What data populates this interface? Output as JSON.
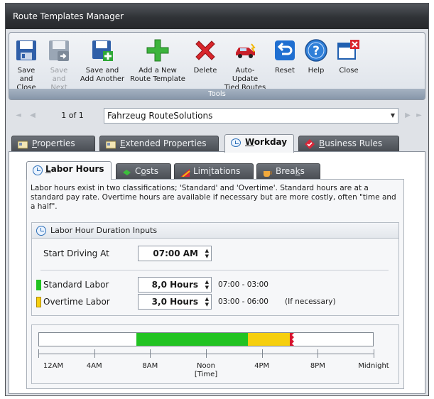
{
  "window": {
    "title": "Route Templates Manager"
  },
  "toolbar": {
    "group_label": "Tools",
    "buttons": [
      {
        "id": "save-close",
        "label": "Save and\nClose",
        "enabled": true
      },
      {
        "id": "save-next",
        "label": "Save and\nNext",
        "enabled": false
      },
      {
        "id": "save-add",
        "label": "Save and\nAdd Another",
        "enabled": true
      },
      {
        "id": "add-new",
        "label": "Add a New\nRoute Template",
        "enabled": true
      },
      {
        "id": "delete",
        "label": "Delete",
        "enabled": true
      },
      {
        "id": "auto-update",
        "label": "Auto-Update\nTied Routes",
        "enabled": true
      },
      {
        "id": "reset",
        "label": "Reset",
        "enabled": true
      },
      {
        "id": "help",
        "label": "Help",
        "enabled": true
      },
      {
        "id": "close",
        "label": "Close",
        "enabled": true
      }
    ]
  },
  "navigator": {
    "count": "1 of 1",
    "selected": "Fahrzeug RouteSolutions"
  },
  "main_tabs": [
    {
      "label": "Properties",
      "accesskey": "P",
      "active": false
    },
    {
      "label": "Extended Properties",
      "accesskey": "E",
      "active": false
    },
    {
      "label": "Workday",
      "accesskey": "W",
      "active": true
    },
    {
      "label": "Business Rules",
      "accesskey": "B",
      "active": false
    }
  ],
  "sub_tabs": [
    {
      "label": "Labor Hours",
      "accesskey": "L",
      "active": true
    },
    {
      "label": "Costs",
      "accesskey": "o",
      "active": false
    },
    {
      "label": "Limitations",
      "accesskey": "i",
      "active": false
    },
    {
      "label": "Breaks",
      "accesskey": "k",
      "active": false
    }
  ],
  "labor": {
    "description": "Labor hours exist in two classifications; 'Standard' and 'Overtime'.  Standard hours are at a standard pay rate.  Overtime hours are available if necessary but are more costly, often \"time and a half\".",
    "group_title": "Labor Hour Duration Inputs",
    "start_label": "Start Driving At",
    "start_value": "07:00 AM",
    "standard_label": "Standard Labor",
    "standard_value": "8,0 Hours",
    "standard_range": "07:00  - 03:00",
    "overtime_label": "Overtime Labor",
    "overtime_value": "3,0 Hours",
    "overtime_range": "03:00  - 06:00",
    "overtime_note": "(If necessary)",
    "colors": {
      "standard": "#22c322",
      "overtime": "#f6cf0e",
      "limit": "#d8142c"
    }
  },
  "timeline": {
    "standard_start_hour": 7,
    "standard_end_hour": 15,
    "overtime_end_hour": 18,
    "ticks": [
      {
        "label": "12AM"
      },
      {
        "label": "4AM"
      },
      {
        "label": "8AM"
      },
      {
        "label": "Noon\n[Time]"
      },
      {
        "label": "4PM"
      },
      {
        "label": "8PM"
      },
      {
        "label": "Midnight"
      }
    ]
  }
}
